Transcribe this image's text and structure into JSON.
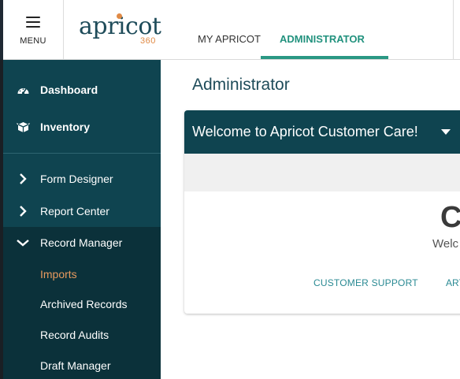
{
  "header": {
    "menu_label": "MENU",
    "logo_word": "apricot",
    "logo_sub": "360",
    "tabs": [
      {
        "label": "MY APRICOT"
      },
      {
        "label": "ADMINISTRATOR"
      }
    ]
  },
  "sidebar": {
    "top_items": [
      {
        "label": "Dashboard",
        "icon": "dashboard-gauge-icon"
      },
      {
        "label": "Inventory",
        "icon": "box-icon"
      }
    ],
    "nav_items": [
      {
        "label": "Form Designer",
        "icon": "chevron-right-icon"
      },
      {
        "label": "Report Center",
        "icon": "chevron-right-icon"
      },
      {
        "label": "Record Manager",
        "icon": "chevron-down-icon"
      }
    ],
    "sub_items": [
      {
        "label": "Imports",
        "active": true
      },
      {
        "label": "Archived Records"
      },
      {
        "label": "Record Audits"
      },
      {
        "label": "Draft Manager"
      }
    ]
  },
  "main": {
    "title": "Administrator",
    "card": {
      "title": "Welcome to Apricot Customer Care!",
      "big_letter": "C",
      "welcome_fragment": "Welc",
      "links": [
        "CUSTOMER SUPPORT",
        "ART"
      ]
    }
  },
  "colors": {
    "sidebar_bg": "#0f4450",
    "accent_teal": "#2a9884",
    "accent_orange": "#e08a45",
    "title_blue": "#1f4c5a"
  }
}
